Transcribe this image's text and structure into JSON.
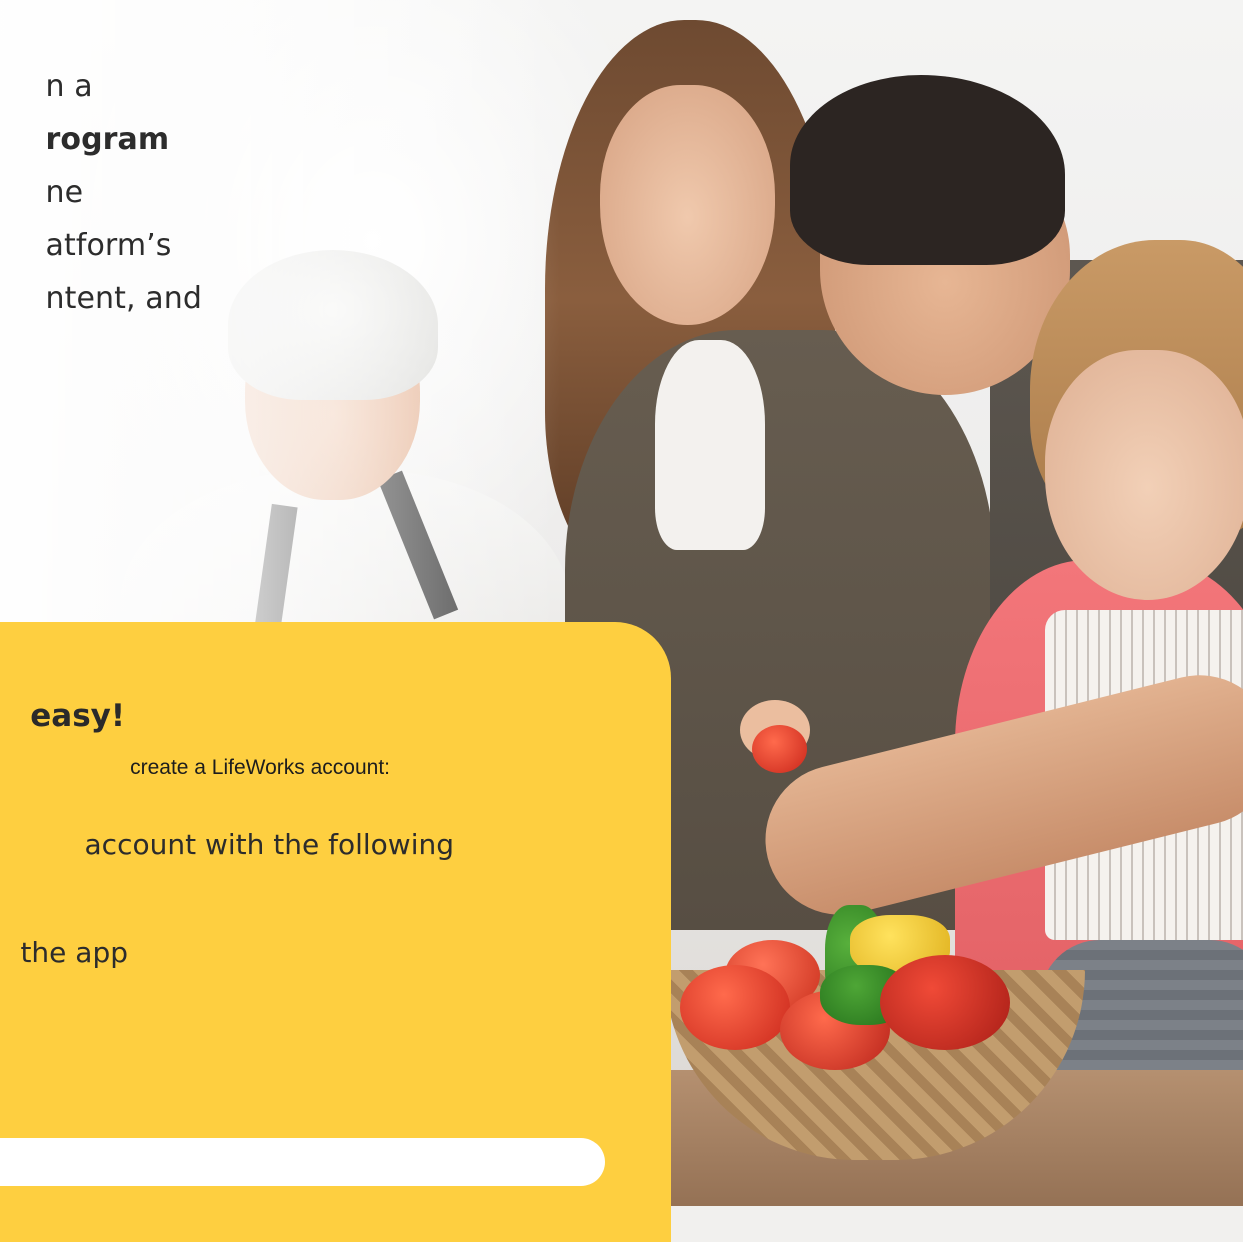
{
  "intro": {
    "lines": [
      {
        "text": "n a",
        "bold": false
      },
      {
        "text": "rogram",
        "bold": true
      },
      {
        "text": "ne",
        "bold": false
      },
      {
        "text": "atform’s",
        "bold": false
      },
      {
        "text": "ntent, and",
        "bold": false
      }
    ]
  },
  "card": {
    "heading": "easy!",
    "subtext": "create a LifeWorks account:",
    "line1": "account with the following",
    "line2": "the app",
    "input_value": "",
    "background_color": "#fecf40"
  },
  "photo": {
    "icon": "family-cooking-photo"
  }
}
